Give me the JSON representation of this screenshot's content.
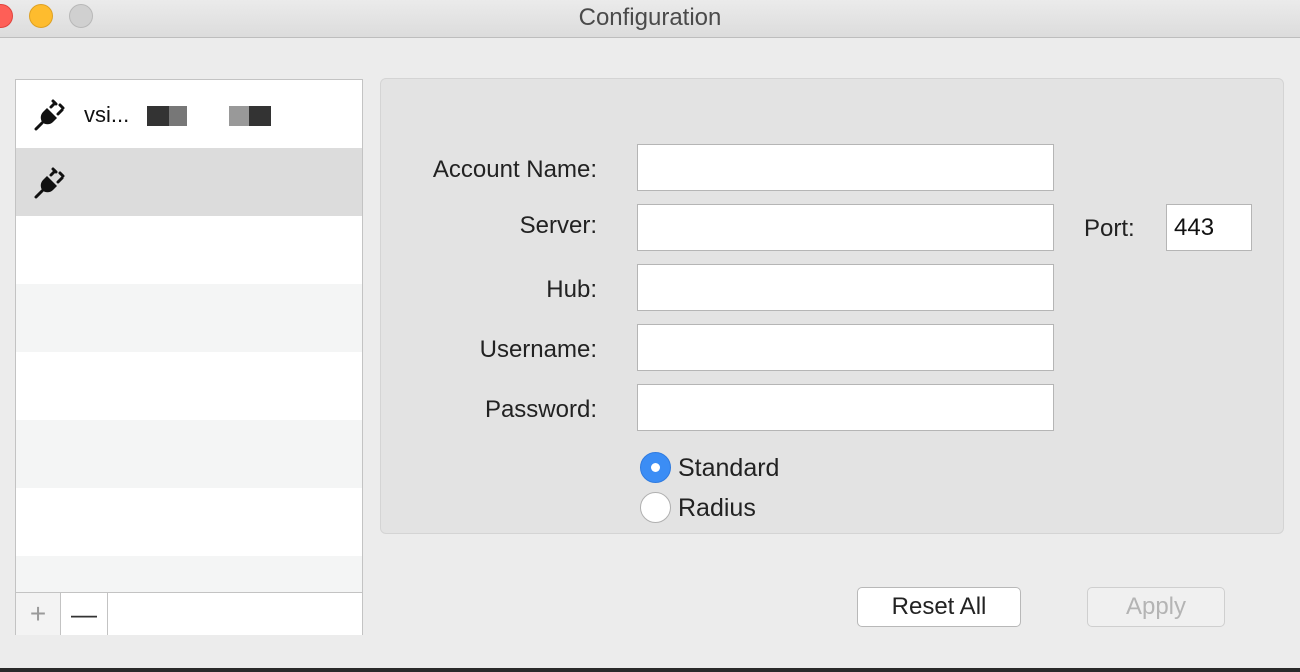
{
  "window": {
    "title": "Configuration"
  },
  "sidebar": {
    "items": [
      {
        "label": "vsi...",
        "icon": "plug-icon",
        "selected": false
      },
      {
        "label": "",
        "icon": "plug-icon",
        "selected": true
      }
    ],
    "add_label": "+",
    "remove_label": "—"
  },
  "form": {
    "account_name_label": "Account Name:",
    "account_name_value": "",
    "server_label": "Server:",
    "server_value": "",
    "port_label": "Port:",
    "port_value": "443",
    "hub_label": "Hub:",
    "hub_value": "",
    "username_label": "Username:",
    "username_value": "",
    "password_label": "Password:",
    "password_value": "",
    "auth_options": [
      {
        "label": "Standard",
        "checked": true
      },
      {
        "label": "Radius",
        "checked": false
      }
    ]
  },
  "buttons": {
    "reset_label": "Reset All",
    "apply_label": "Apply"
  },
  "colors": {
    "accent": "#3b8df5",
    "selected_row": "#dcdcdc"
  }
}
